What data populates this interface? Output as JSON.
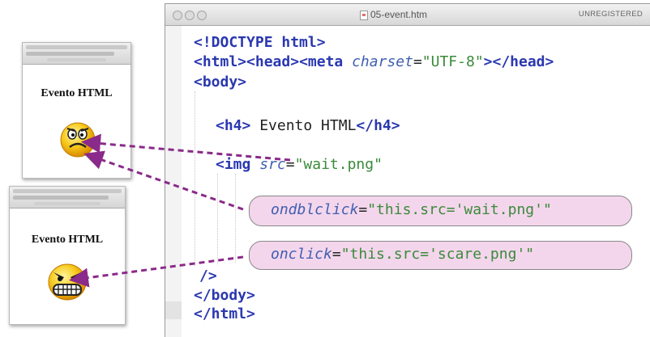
{
  "editor": {
    "title": "05-event.htm",
    "badge": "UNREGISTERED",
    "line1": "<!DOCTYPE html>",
    "line2": {
      "html": "<html>",
      "head": "<head>",
      "meta": "<meta",
      "charset_attr": "charset",
      "eq": "=",
      "charset_val": "\"UTF-8\"",
      "close": ">",
      "head_close": "</head>"
    },
    "line3": "<body>",
    "line4": {
      "open": "<h4>",
      "text": " Evento HTML",
      "close": "</h4>"
    },
    "line5": {
      "tag": "<img",
      "attr": "src",
      "eq": "=",
      "val": "\"wait.png\""
    },
    "line6": {
      "attr": "ondblclick",
      "eq": "=",
      "val": "\"this.src='wait.png'\""
    },
    "line7": {
      "attr": "onclick",
      "eq": "=",
      "val": "\"this.src='scare.png'\""
    },
    "line8": "/>",
    "line9": "</body>",
    "line10": "</html>"
  },
  "preview_top": {
    "heading": "Evento HTML",
    "icon": "worried-face-icon"
  },
  "preview_bottom": {
    "heading": "Evento HTML",
    "icon": "angry-face-icon"
  },
  "colors": {
    "tag": "#2a38b0",
    "attribute": "#3f5fb0",
    "string": "#3a8a3a",
    "pill": "#f4d6ec",
    "arrow": "#8a2a8a"
  }
}
